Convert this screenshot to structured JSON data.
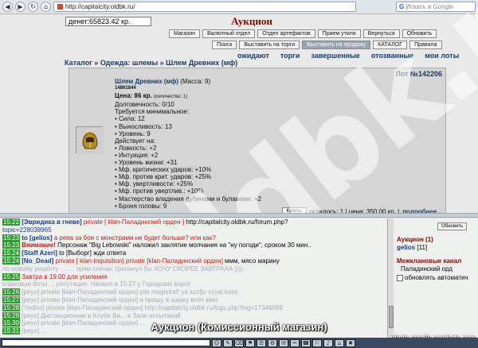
{
  "browser": {
    "back_glyph": "◀",
    "forward_glyph": "▶",
    "reload_glyph": "↻",
    "home_glyph": "⌂",
    "url": "http://capitalcity.oldbk.ru/",
    "search_engine_glyph": "G",
    "search_placeholder": "Искать в Google"
  },
  "header": {
    "money": "денег:65823.42 кр.",
    "title": "Аукцион"
  },
  "buttons_row1": [
    "Магазин",
    "Валютный отдел",
    "Отдел артефактов",
    "Прием утиля",
    "Вернуться",
    "Обновить"
  ],
  "buttons_row2": [
    "Поиск",
    "Выставить на торги",
    "Выставить на продажу",
    "КАТАЛОГ",
    "Правила"
  ],
  "active_button": "Выставить на продажу",
  "sub_tabs": [
    "ожидают",
    "торги",
    "завершенные",
    "отозванные",
    "мои лоты"
  ],
  "breadcrumb": "Каталог » Одежда: шлемы » Шлем Древних (мф)",
  "lot": {
    "number": "Лот №142206",
    "name": "Шлем Древних (мф)",
    "mass": "(Масса: 9)",
    "item_id": "14861844",
    "price": "Цена: 86 кр.",
    "quantity": "(количество: 1)",
    "durability": "Долговечность: 0/10",
    "req_title": "Требуется минимальное:",
    "requirements": [
      "• Сила: 12",
      "• Выносливость: 13",
      "• Уровень: 9"
    ],
    "effects_title": "Действует на:",
    "effects": [
      "• Ловкость: +2",
      "• Интуиция: +2",
      "• Уровень жизни: +31",
      "• Мф. критических ударов: +10%",
      "• Мф. против крит. ударов: +25%",
      "• Мф. увертливости: +25%",
      "• Мф. против увертлив.: +10%",
      "• Мастерство владения дубинами и булавами: +2",
      "• Броня головы: 9"
    ],
    "buy_label": "Купить",
    "remaining": "осталось: 1 | цена: 350.00 кр. |",
    "more": "подробнее..."
  },
  "chat_lines": [
    {
      "time": "15:22",
      "parts": [
        [
          "nick",
          "[Эвридика в гневе]"
        ],
        [
          "priv",
          " private [ klan-Паладинский орден ]"
        ],
        [
          "plain",
          " http://capitalcity.oldbk.ru/forum.php?"
        ]
      ]
    },
    {
      "time": "",
      "parts": [
        [
          "link",
          "topic=228038965"
        ]
      ]
    },
    {
      "time": "15:23",
      "parts": [
        [
          "nick",
          "to [gelios]"
        ],
        [
          "priv",
          " а репа за бои с монстрами не будет больше? или как?"
        ]
      ]
    },
    {
      "time": "15:23",
      "parts": [
        [
          "sys",
          "Внимание!"
        ],
        [
          "plain",
          " Персонаж \"Big Lebowski\" наложил заклятие молчания на \"ну погоди\", сроком 30 мин.."
        ]
      ]
    },
    {
      "time": "15:24",
      "parts": [
        [
          "nick",
          "[Staff Azeri]"
        ],
        [
          "plain",
          " to [Выборг] жди ответа"
        ]
      ]
    },
    {
      "time": "15:24",
      "parts": [
        [
          "nick",
          "[No_Dead]"
        ],
        [
          "priv",
          " private [ klan-Inquisition] private [klan-Паладинский орден]"
        ],
        [
          "plain",
          " ммм, мясо марину"
        ]
      ]
    },
    {
      "time": "",
      "parts": [
        [
          "muted",
          "по новому рецепту ........ прям сейчас трепанул бы ХОЧУ СКОРЕЕ ЗАВТРААА ))))"
        ]
      ]
    },
    {
      "time": "15:25",
      "parts": [
        [
          "red",
          "Завтра в 19:00 для усиления"
        ]
      ]
    },
    {
      "time": "",
      "parts": [
        [
          "muted",
          "клановые боты ... репутация. Начало в 15:27 у Городских ворот"
        ]
      ]
    },
    {
      "time": "15:26",
      "parts": [
        [
          "muted",
          "[peyo] private [klan-Паладинский орден] pile magistrat! ya szofju vzyat kves"
        ]
      ]
    },
    {
      "time": "15:27",
      "parts": [
        [
          "muted",
          "[peyo] private [klan-Паладинский орден] а прошу в шарку влет квес"
        ]
      ]
    },
    {
      "time": "15:28",
      "parts": [
        [
          "muted",
          "[Yedlos] private [klan-Паладинский орден] http://capitalcity.oldbk.ru/logs.php?log=17346099"
        ]
      ]
    },
    {
      "time": "15:29",
      "parts": [
        [
          "muted",
          "[peyo] Дистанционник в Клубе Ва... в Зале испытаний"
        ]
      ]
    },
    {
      "time": "15:30",
      "parts": [
        [
          "muted",
          "[peyo] private [klan-Паладинский орден] ..."
        ]
      ]
    },
    {
      "time": "15:31",
      "parts": [
        [
          "muted",
          "[peyo] ..."
        ]
      ]
    }
  ],
  "side": {
    "refresh": "Обновить",
    "room": "Аукцион (1)",
    "user_name": "gelios",
    "user_level": "[11]",
    "chan_head": "Межклановые канал",
    "chan_item": "Паладинский орд",
    "auto_refresh": "обновлять автоматич"
  },
  "caption": "Аукцион (Комиссионный магазин)",
  "credit": "photo.scrolls.combats.com",
  "watermark": "oldbk.ru",
  "toolbar_icons": [
    "☺",
    "✎",
    "⌫",
    "⚑",
    "☰",
    "⚙",
    "✉",
    "✂",
    "☎",
    "⚐",
    "♪",
    "⌂",
    "✖"
  ]
}
